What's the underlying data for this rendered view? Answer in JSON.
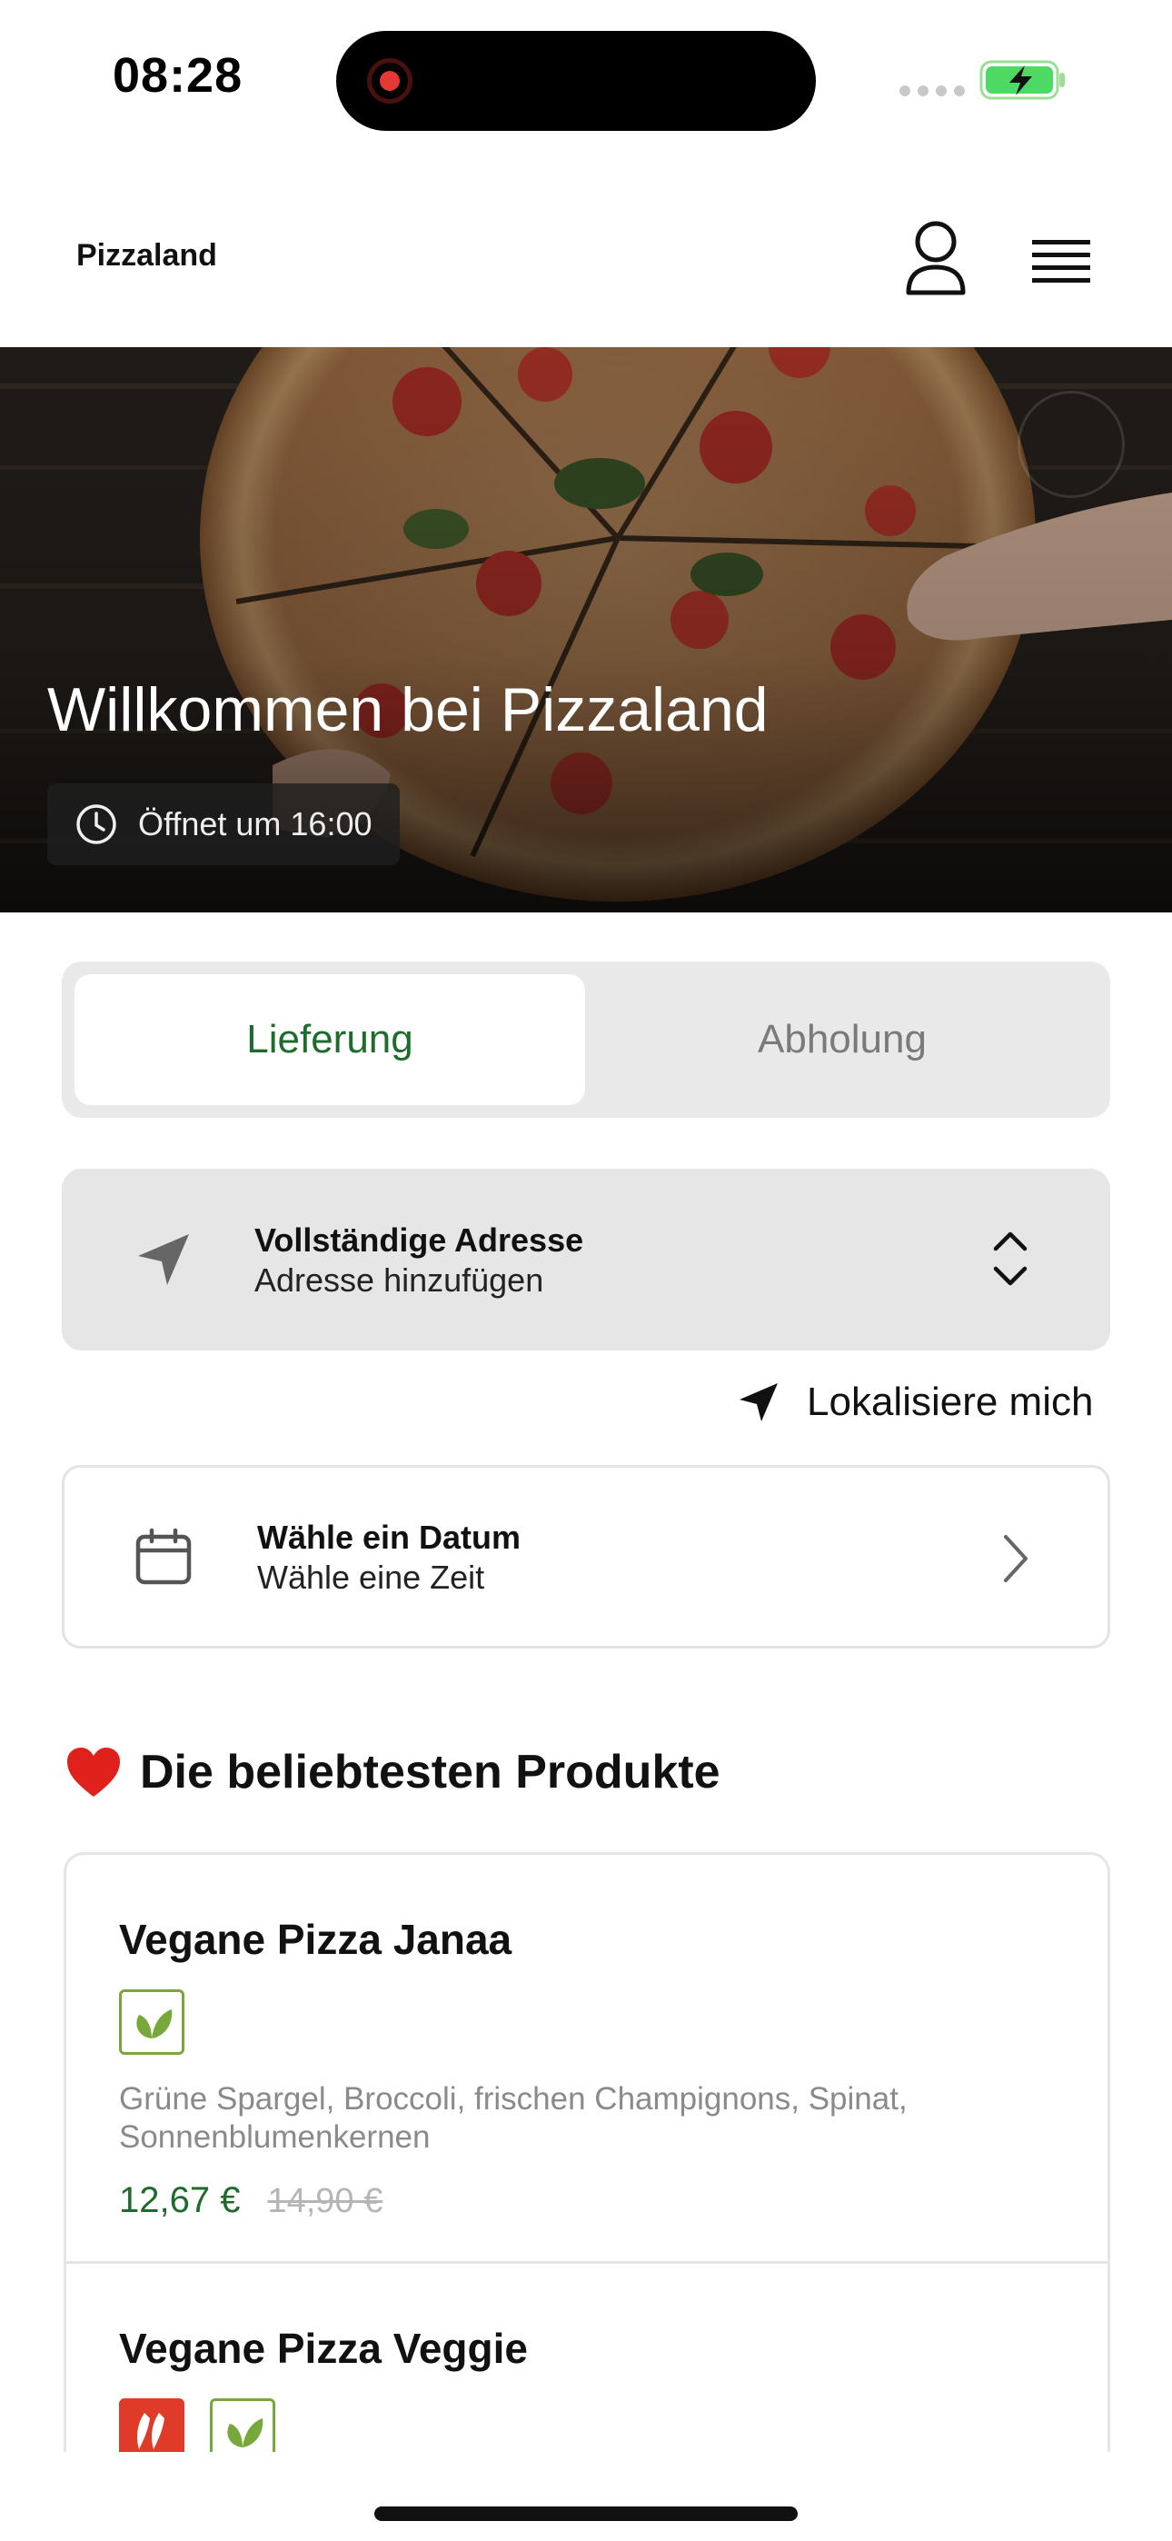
{
  "status_bar": {
    "time": "08:28"
  },
  "header": {
    "brand": "Pizzaland",
    "icons": [
      "user-icon",
      "hamburger-menu-icon"
    ]
  },
  "hero": {
    "title": "Willkommen bei Pizzaland",
    "opening_text": "Öffnet um 16:00",
    "icon": "clock-icon"
  },
  "order_mode": {
    "tabs": [
      {
        "label": "Lieferung",
        "active": true
      },
      {
        "label": "Abholung",
        "active": false
      }
    ]
  },
  "address": {
    "title": "Vollständige Adresse",
    "subtitle": "Adresse hinzufügen",
    "icon": "navigation-arrow-icon"
  },
  "locate": {
    "label": "Lokalisiere mich",
    "icon": "navigation-arrow-icon"
  },
  "schedule": {
    "title": "Wähle ein Datum",
    "subtitle": "Wähle eine Zeit",
    "icon": "calendar-icon"
  },
  "popular": {
    "title": "Die beliebtesten Produkte",
    "emoji": "❤️",
    "products": [
      {
        "name": "Vegane Pizza Janaa",
        "tags": [
          "vegan-leaf-icon"
        ],
        "description": "Grüne Spargel, Broccoli, frischen Champignons, Spinat, Sonnenblumenkernen",
        "price": "12,67 €",
        "old_price": "14,90 €"
      },
      {
        "name": "Vegane Pizza Veggie",
        "tags": [
          "spicy-chili-icon",
          "vegan-leaf-icon"
        ]
      }
    ]
  },
  "colors": {
    "accent_green": "#1e6b2c",
    "vegan_green": "#76a83a",
    "spicy_red": "#e03a28",
    "battery_green": "#4cd964"
  }
}
